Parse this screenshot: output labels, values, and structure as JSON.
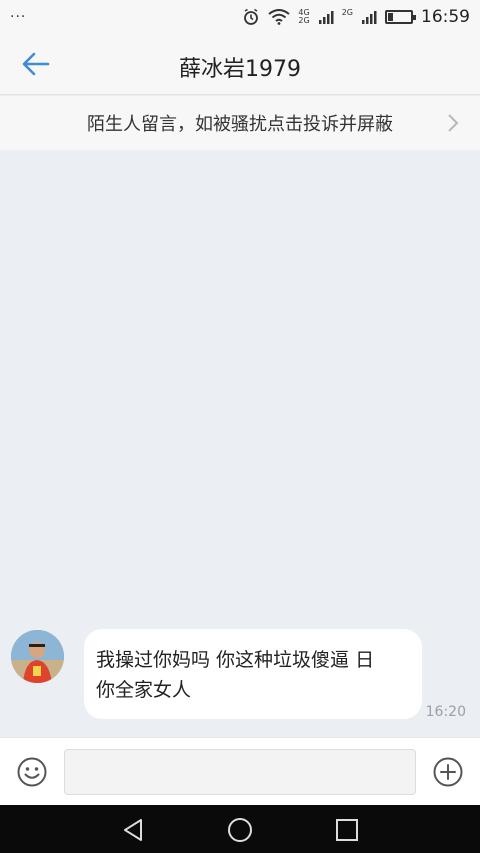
{
  "status_bar": {
    "dots": "···",
    "network_top": "4G",
    "network_bottom": "2G",
    "network2": "2G",
    "time": "16:59",
    "battery_level": 0.2
  },
  "header": {
    "title": "薛冰岩1979"
  },
  "notice": {
    "text": "陌生人留言，如被骚扰点击投诉并屏蔽"
  },
  "messages": [
    {
      "line1": "我操过你妈吗 你这种垃圾傻逼 日",
      "line2": "你全家女人",
      "time": "16:20"
    }
  ],
  "input": {
    "placeholder": ""
  },
  "icons": {
    "back": "back-arrow-icon",
    "chevron": "chevron-right-icon",
    "emoji": "emoji-icon",
    "plus": "plus-icon",
    "nav_back": "triangle-back-icon",
    "nav_home": "circle-home-icon",
    "nav_recent": "square-recent-icon"
  },
  "colors": {
    "accent": "#3f8bd9",
    "chat_bg": "#ebeef2"
  }
}
